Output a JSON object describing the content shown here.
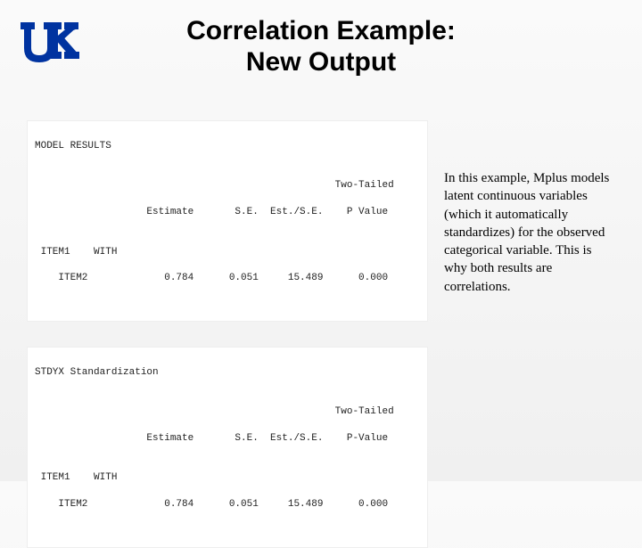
{
  "title_line1": "Correlation Example:",
  "title_line2": "New Output",
  "logo": {
    "text": "UK"
  },
  "panel1": {
    "section": "MODEL RESULTS",
    "header": "                                                   Two-Tailed",
    "header2": "                   Estimate       S.E.  Est./S.E.    P Value",
    "with": " ITEM1    WITH",
    "row": "    ITEM2             0.784      0.051     15.489      0.000"
  },
  "panel2": {
    "section": "STDYX Standardization",
    "header": "                                                   Two-Tailed",
    "header2": "                   Estimate       S.E.  Est./S.E.    P-Value",
    "with": " ITEM1    WITH",
    "row": "    ITEM2             0.784      0.051     15.489      0.000"
  },
  "explanation": "In this example, Mplus models latent continuous variables (which it automatically standardizes) for the observed categorical variable. This is why both results are correlations.",
  "chart_data": {
    "type": "table",
    "title": "Correlation Example: New Output",
    "tables": [
      {
        "section": "MODEL RESULTS",
        "columns": [
          "",
          "Estimate",
          "S.E.",
          "Est./S.E.",
          "Two-Tailed P Value"
        ],
        "rows": [
          {
            "relation": "ITEM1 WITH ITEM2",
            "Estimate": 0.784,
            "S.E.": 0.051,
            "Est./S.E.": 15.489,
            "P": 0.0
          }
        ]
      },
      {
        "section": "STDYX Standardization",
        "columns": [
          "",
          "Estimate",
          "S.E.",
          "Est./S.E.",
          "Two-Tailed P-Value"
        ],
        "rows": [
          {
            "relation": "ITEM1 WITH ITEM2",
            "Estimate": 0.784,
            "S.E.": 0.051,
            "Est./S.E.": 15.489,
            "P": 0.0
          }
        ]
      }
    ]
  }
}
